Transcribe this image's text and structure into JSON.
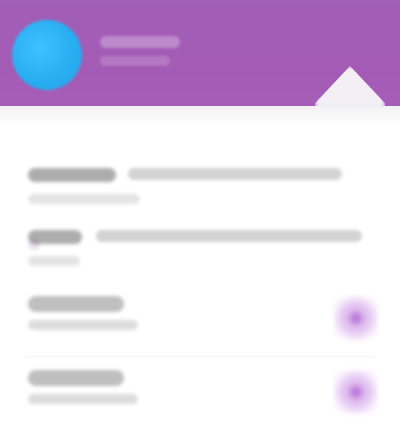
{
  "header": {
    "title": "",
    "subtitle": "",
    "background_color": "#a65eb8",
    "avatar_color": "#2aa0e4"
  },
  "content": {
    "section_label": "",
    "paragraph_1": {
      "line_1": "",
      "line_2": ""
    },
    "paragraph_2": {
      "line_1": "",
      "line_2": ""
    }
  },
  "rows": [
    {
      "title": "",
      "subtitle": "",
      "action_icon": "settings-icon",
      "action_color": "#c68ee0"
    },
    {
      "title": "",
      "subtitle": "",
      "action_icon": "settings-icon",
      "action_color": "#c68ee0"
    }
  ]
}
